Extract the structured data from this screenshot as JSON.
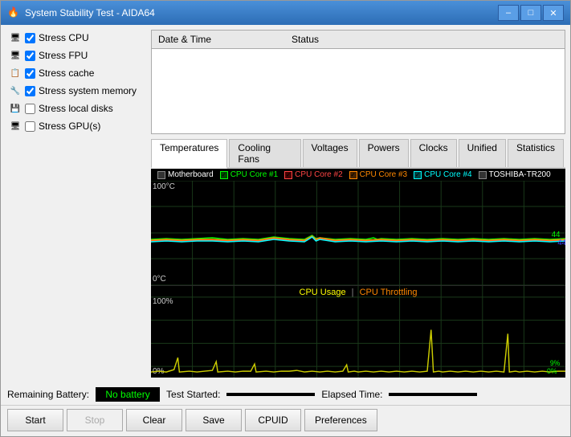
{
  "window": {
    "title": "System Stability Test - AIDA64",
    "icon": "🔥"
  },
  "title_controls": {
    "minimize": "–",
    "maximize": "□",
    "close": "✕"
  },
  "checkboxes": [
    {
      "id": "stress-cpu",
      "label": "Stress CPU",
      "checked": true,
      "icon": "💻"
    },
    {
      "id": "stress-fpu",
      "label": "Stress FPU",
      "checked": true,
      "icon": "🖥"
    },
    {
      "id": "stress-cache",
      "label": "Stress cache",
      "checked": true,
      "icon": "📋"
    },
    {
      "id": "stress-memory",
      "label": "Stress system memory",
      "checked": true,
      "icon": "🔧"
    },
    {
      "id": "stress-disks",
      "label": "Stress local disks",
      "checked": false,
      "icon": "💾"
    },
    {
      "id": "stress-gpu",
      "label": "Stress GPU(s)",
      "checked": false,
      "icon": "🖥"
    }
  ],
  "status_table": {
    "col1": "Date & Time",
    "col2": "Status"
  },
  "tabs": [
    {
      "id": "temperatures",
      "label": "Temperatures",
      "active": true
    },
    {
      "id": "cooling-fans",
      "label": "Cooling Fans",
      "active": false
    },
    {
      "id": "voltages",
      "label": "Voltages",
      "active": false
    },
    {
      "id": "powers",
      "label": "Powers",
      "active": false
    },
    {
      "id": "clocks",
      "label": "Clocks",
      "active": false
    },
    {
      "id": "unified",
      "label": "Unified",
      "active": false
    },
    {
      "id": "statistics",
      "label": "Statistics",
      "active": false
    }
  ],
  "chart_upper": {
    "y_top": "100°C",
    "y_bottom": "0°C",
    "value_right1": "44",
    "value_right2": "44",
    "legend": [
      {
        "label": "Motherboard",
        "color": "white",
        "checked": false
      },
      {
        "label": "CPU Core #1",
        "color": "#00ff00",
        "checked": true
      },
      {
        "label": "CPU Core #2",
        "color": "#ff4444",
        "checked": true
      },
      {
        "label": "CPU Core #3",
        "color": "#ff8800",
        "checked": true
      },
      {
        "label": "CPU Core #4",
        "color": "#00ffff",
        "checked": true
      },
      {
        "label": "TOSHIBA-TR200",
        "color": "white",
        "checked": false
      }
    ]
  },
  "chart_lower": {
    "y_top": "100%",
    "y_bottom": "0%",
    "title": "CPU Usage",
    "title2": "CPU Throttling",
    "value_right1": "9%",
    "value_right2": "0%",
    "separator": "|"
  },
  "bottom_bar": {
    "battery_label": "Remaining Battery:",
    "battery_value": "No battery",
    "test_started_label": "Test Started:",
    "test_started_value": "",
    "elapsed_label": "Elapsed Time:",
    "elapsed_value": ""
  },
  "buttons": {
    "start": "Start",
    "stop": "Stop",
    "clear": "Clear",
    "save": "Save",
    "cpuid": "CPUID",
    "preferences": "Preferences"
  }
}
